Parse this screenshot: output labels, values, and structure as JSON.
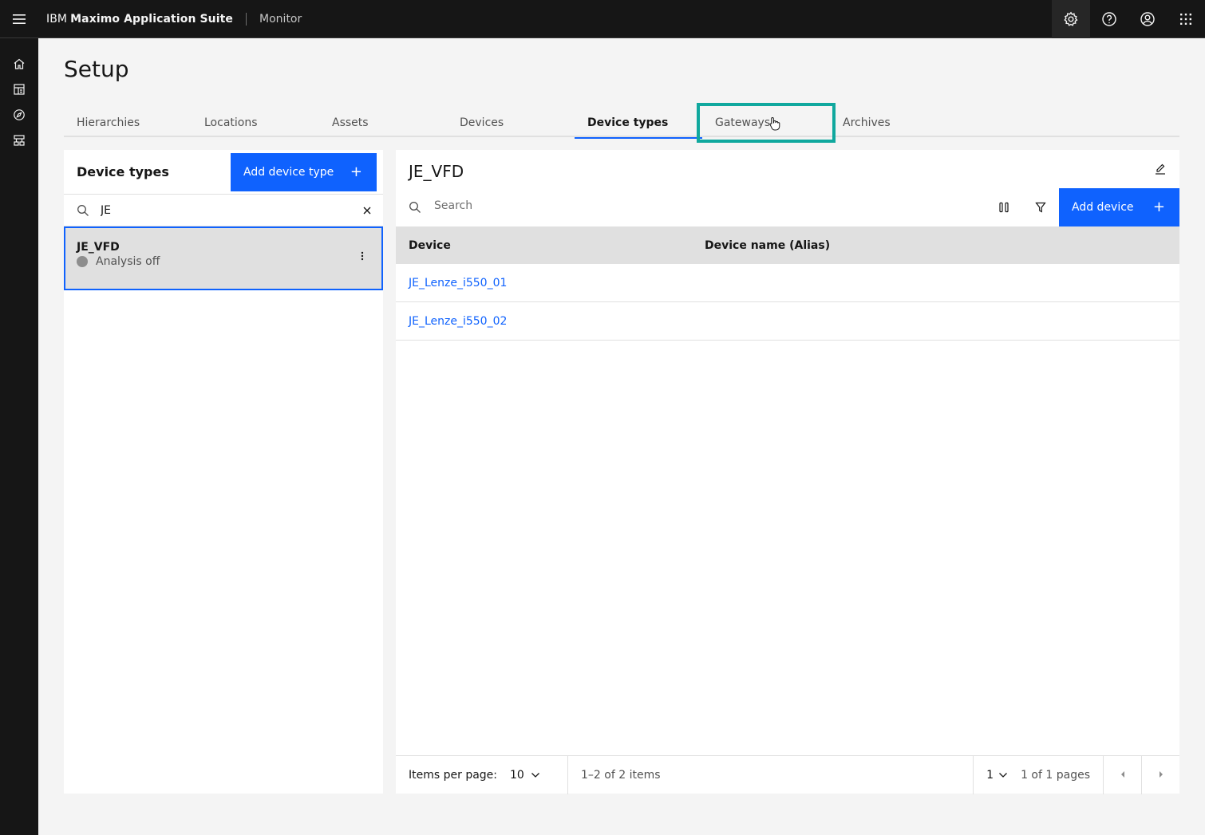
{
  "header": {
    "brand_prefix": "IBM",
    "brand_name": "Maximo Application Suite",
    "app_name": "Monitor",
    "actions": [
      "settings-icon",
      "help-icon",
      "user-icon",
      "app-switcher-icon"
    ]
  },
  "siderail": {
    "items": [
      "home-icon",
      "dashboard-icon",
      "explore-icon",
      "setup-icon"
    ]
  },
  "page": {
    "title": "Setup"
  },
  "tabs": [
    {
      "label": "Hierarchies"
    },
    {
      "label": "Locations"
    },
    {
      "label": "Assets"
    },
    {
      "label": "Devices"
    },
    {
      "label": "Device types",
      "selected": true
    },
    {
      "label": "Gateways",
      "highlighted": true
    },
    {
      "label": "Archives"
    }
  ],
  "left_panel": {
    "title": "Device types",
    "add_button": "Add device type",
    "search_value": "JE",
    "items": [
      {
        "name": "JE_VFD",
        "status": "Analysis off"
      }
    ]
  },
  "right_panel": {
    "title": "JE_VFD",
    "search_placeholder": "Search",
    "add_button": "Add device",
    "columns": [
      "Device",
      "Device name (Alias)"
    ],
    "rows": [
      {
        "device": "JE_Lenze_i550_01",
        "alias": ""
      },
      {
        "device": "JE_Lenze_i550_02",
        "alias": ""
      }
    ],
    "pagination": {
      "items_per_page_label": "Items per page:",
      "items_per_page": "10",
      "range": "1–2 of 2 items",
      "page": "1",
      "page_of": "1 of 1 pages"
    }
  },
  "colors": {
    "primary": "#0f62fe",
    "highlight": "#10a89e",
    "header_bg": "#161616"
  }
}
